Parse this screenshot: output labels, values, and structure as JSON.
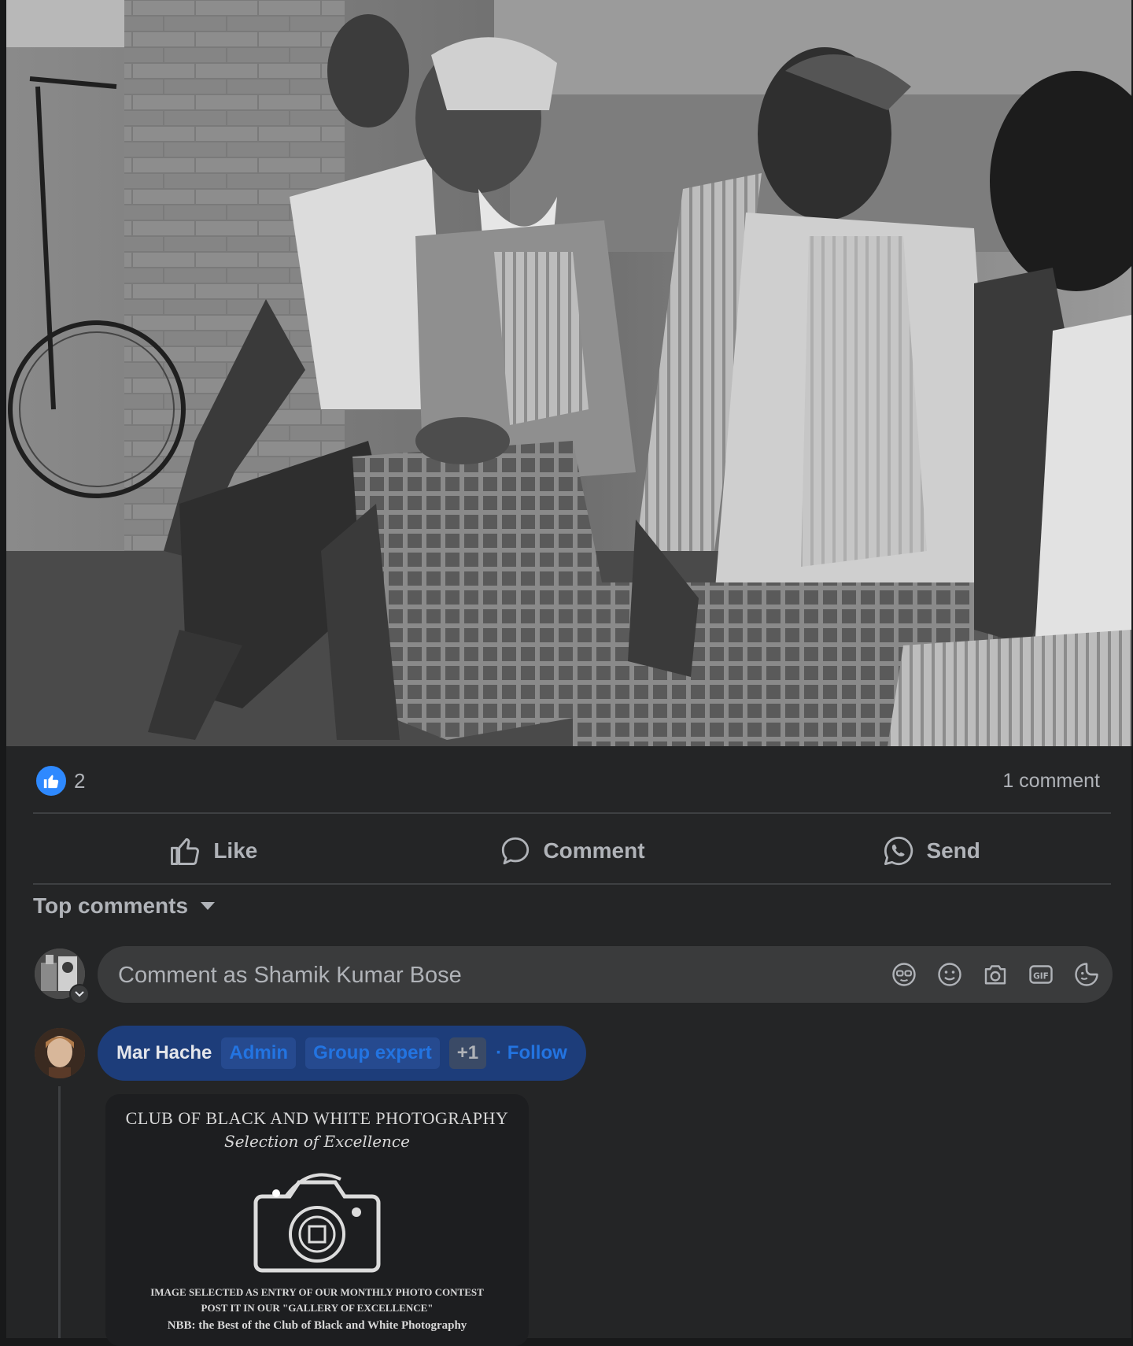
{
  "post": {
    "photo_alt": "Black and white photograph of men seated against a brick wall",
    "reactions": {
      "icon": "thumbs-up-icon",
      "count": "2",
      "accent": "#2e89ff"
    },
    "comment_count": "1 comment"
  },
  "actions": {
    "like_label": "Like",
    "comment_label": "Comment",
    "send_label": "Send"
  },
  "comments_section": {
    "sort_label": "Top comments",
    "composer_placeholder": "Comment as Shamik Kumar Bose",
    "composer_icons": [
      "avatar-sticker-icon",
      "emoji-icon",
      "camera-icon",
      "gif-icon",
      "sticker-icon"
    ]
  },
  "comment": {
    "author": "Mar Hache",
    "badges": [
      "Admin",
      "Group expert",
      "+1"
    ],
    "follow_label": "· Follow",
    "attachment": {
      "title": "CLUB OF BLACK AND WHITE PHOTOGRAPHY",
      "subtitle": "Selection of Excellence",
      "line1": "IMAGE SELECTED AS ENTRY OF OUR MONTHLY PHOTO CONTEST",
      "line2": "POST IT IN OUR \"GALLERY OF EXCELLENCE\"",
      "line3": "NBB: the Best of the Club of Black and White Photography"
    }
  },
  "colors": {
    "background": "#242526",
    "surface": "#3a3b3c",
    "text_secondary": "#b0b3b8",
    "link_blue": "#2374e1"
  }
}
